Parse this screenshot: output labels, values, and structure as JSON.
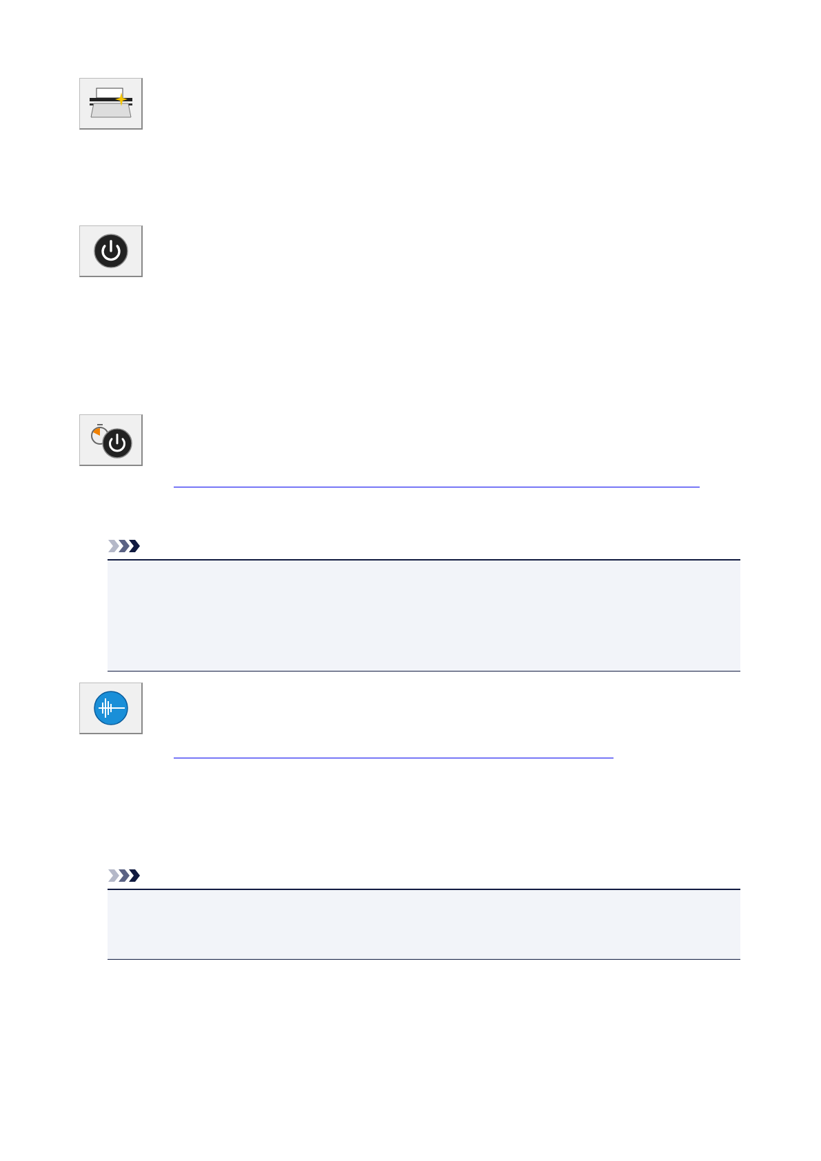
{
  "blocks": [
    {
      "kind": "icon-button"
    },
    {
      "kind": "icon-button"
    },
    {
      "kind": "icon-button"
    },
    {
      "kind": "link-rule"
    },
    {
      "kind": "note"
    },
    {
      "kind": "icon-button"
    },
    {
      "kind": "link-rule"
    },
    {
      "kind": "note"
    }
  ]
}
